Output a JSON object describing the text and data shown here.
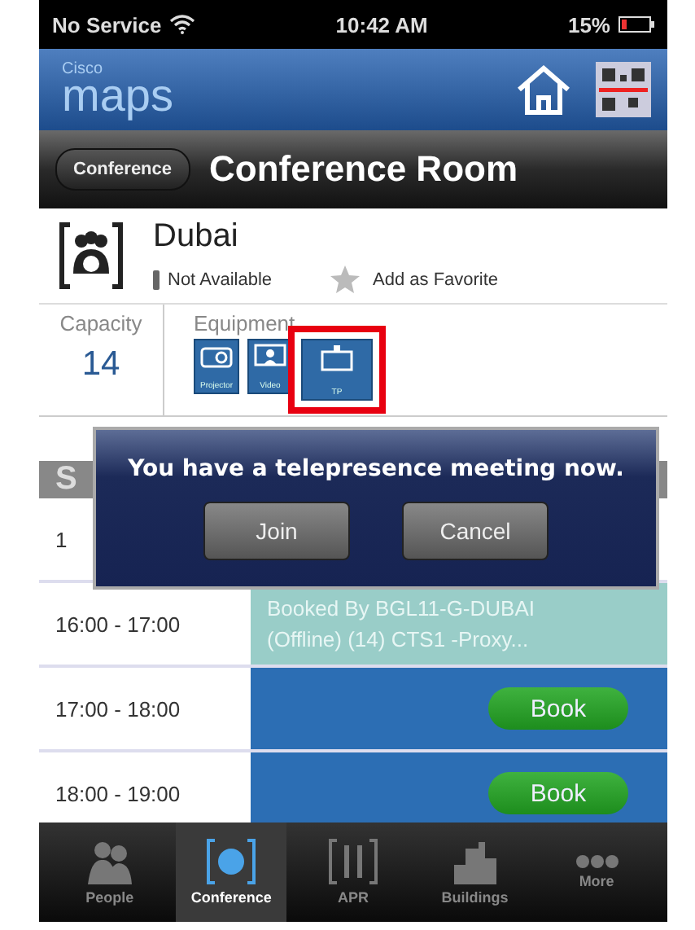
{
  "status_bar": {
    "carrier": "No Service",
    "time": "10:42 AM",
    "battery": "15%"
  },
  "header": {
    "brand_small": "Cisco",
    "brand_large": "maps"
  },
  "nav_bar": {
    "back": "Conference",
    "title": "Conference Room"
  },
  "room": {
    "name": "Dubai",
    "availability": "Not Available",
    "favorite_label": "Add as Favorite",
    "favorite": false
  },
  "details": {
    "capacity_label": "Capacity",
    "capacity": "14",
    "equipment_label": "Equipment",
    "equipment": [
      {
        "kind": "projector",
        "label": "Projector",
        "highlighted": false
      },
      {
        "kind": "video",
        "label": "Video",
        "highlighted": false
      },
      {
        "kind": "tp",
        "label": "TP",
        "highlighted": true
      }
    ]
  },
  "schedule": {
    "header": "S",
    "rows": [
      {
        "time": "1",
        "kind": "covered"
      },
      {
        "time": "16:00 - 17:00",
        "kind": "booked",
        "text": "Booked By BGL11-G-DUBAI (Offline) (14) CTS1 -Proxy..."
      },
      {
        "time": "17:00 - 18:00",
        "kind": "available",
        "button": "Book"
      },
      {
        "time": "18:00 - 19:00",
        "kind": "available",
        "button": "Book"
      }
    ]
  },
  "alert": {
    "message": "You have a telepresence meeting now.",
    "buttons": [
      "Join",
      "Cancel"
    ]
  },
  "tab_bar": [
    {
      "label": "People",
      "kind": "people",
      "selected": false
    },
    {
      "label": "Conference",
      "kind": "conference",
      "selected": true
    },
    {
      "label": "APR",
      "kind": "apr",
      "selected": false
    },
    {
      "label": "Buildings",
      "kind": "buildings",
      "selected": false
    },
    {
      "label": "More",
      "kind": "more",
      "selected": false
    }
  ]
}
